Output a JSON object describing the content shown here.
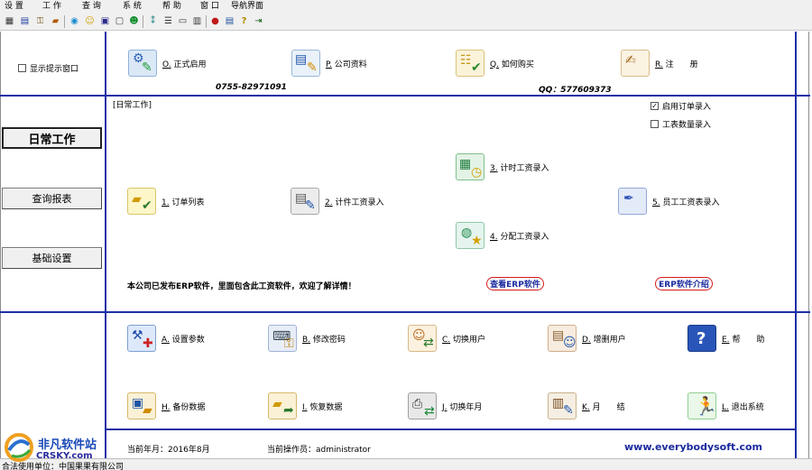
{
  "menu": [
    "设 置",
    "工 作",
    "查 询",
    "系 统",
    "帮 助",
    "窗 口",
    "导航界面"
  ],
  "toolbar_icons": [
    "grid-icon",
    "table-icon",
    "key-icon",
    "cake-icon",
    "globe-icon",
    "smiley-icon",
    "calendar-icon",
    "window-icon",
    "emoji-icon",
    "tree-icon",
    "list-icon",
    "monitor-icon",
    "layout-icon",
    "apple-icon",
    "document-icon",
    "help-icon",
    "exit-icon"
  ],
  "left": {
    "show_tips_label": "显示提示窗口",
    "btn_daily": "日常工作",
    "btn_query": "查询报表",
    "btn_basic": "基础设置"
  },
  "top_items": {
    "start": {
      "key": "O.",
      "label": "正式启用"
    },
    "company": {
      "key": "P.",
      "label": "公司资料"
    },
    "buy": {
      "key": "Q.",
      "label": "如何购买"
    },
    "register": {
      "key": "R.",
      "label": "注　　册"
    }
  },
  "contact": {
    "phone": "0755-82971091",
    "qq": "QQ：577609373"
  },
  "daily": {
    "section_title": "[日常工作]",
    "enable_order": "启用订单录入",
    "enable_order_checked": true,
    "process_qty": "工表数量录入",
    "process_qty_checked": false,
    "items": {
      "order_list": {
        "key": "1.",
        "label": "订单列表"
      },
      "piece_wage": {
        "key": "2.",
        "label": "计件工资录入"
      },
      "time_wage": {
        "key": "3.",
        "label": "计时工资录入"
      },
      "alloc_wage": {
        "key": "4.",
        "label": "分配工资录入"
      },
      "staff_wage": {
        "key": "5.",
        "label": "员工工资表录入"
      }
    },
    "erp_note": "本公司已发布ERP软件，里面包含此工资软件，欢迎了解详情！",
    "btn_view_erp": "查看ERP软件",
    "btn_erp_intro": "ERP软件介绍"
  },
  "system_items": {
    "params": {
      "key": "A.",
      "label": "设置参数"
    },
    "password": {
      "key": "B.",
      "label": "修改密码"
    },
    "switch_user": {
      "key": "C.",
      "label": "切换用户"
    },
    "add_user": {
      "key": "D.",
      "label": "增删用户"
    },
    "help": {
      "key": "E.",
      "label": "帮　　助"
    },
    "backup": {
      "key": "H.",
      "label": "备份数据"
    },
    "restore": {
      "key": "I.",
      "label": "恢复数据"
    },
    "switch_month": {
      "key": "J.",
      "label": "切换年月"
    },
    "month_end": {
      "key": "K.",
      "label": "月　　结"
    },
    "exit": {
      "key": "L.",
      "label": "退出系统"
    }
  },
  "status": {
    "current_month": "当前年月：2016年8月",
    "current_operator": "当前操作员：administrator",
    "url": "www.everybodysoft.com",
    "licensed_to": "合法使用单位：中国果果有限公司",
    "watermark_cn": "非凡软件站",
    "watermark_en": "CRSKY.com"
  },
  "colors": {
    "frame_blue": "#1c2fa6",
    "pill_border": "#d31b1b",
    "link_blue": "#1a2a9e"
  }
}
